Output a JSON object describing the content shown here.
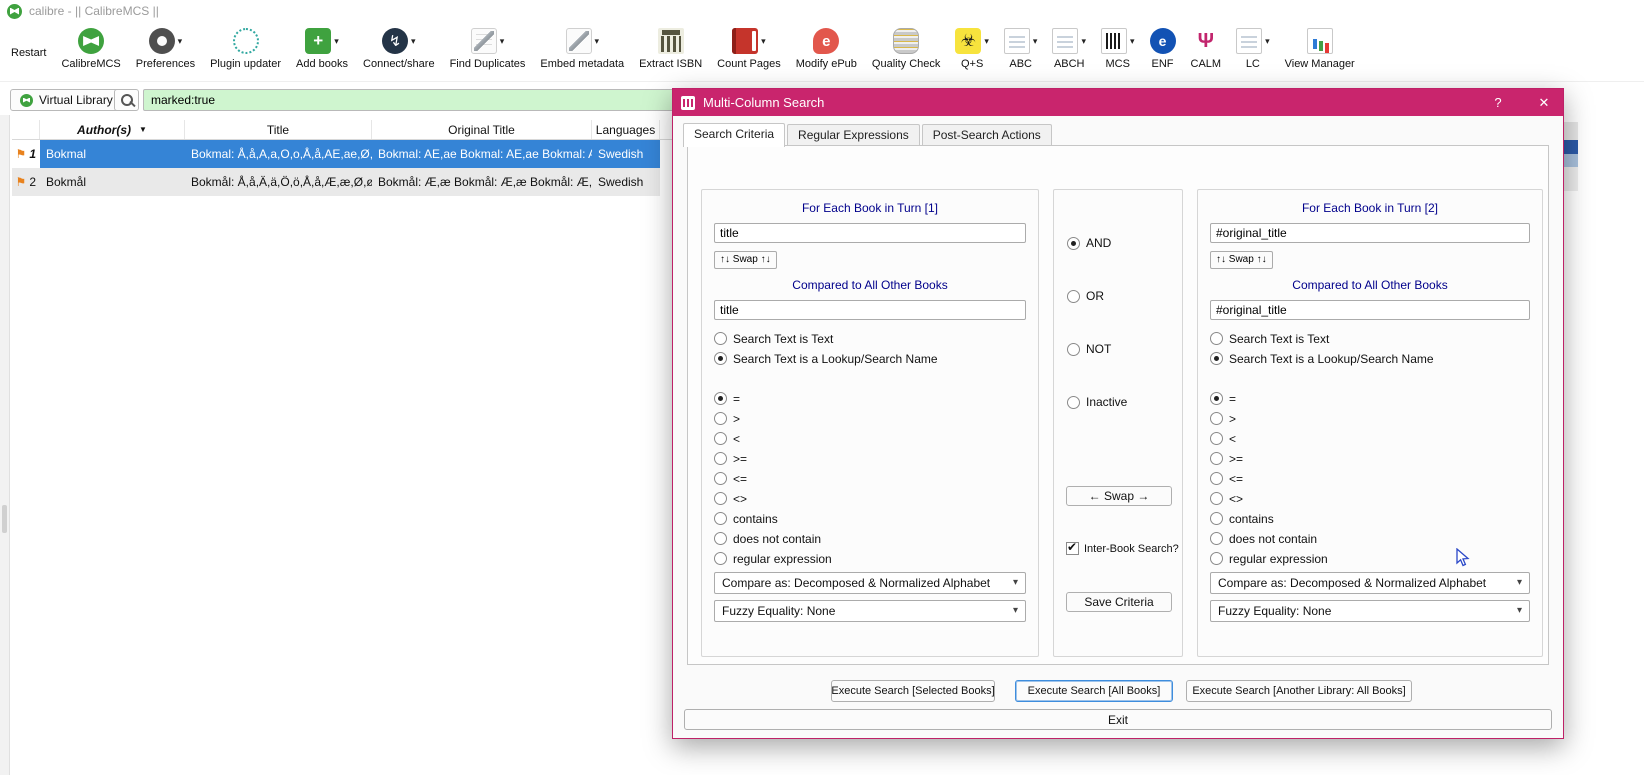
{
  "window": {
    "title": "calibre - || CalibreMCS ||"
  },
  "toolbar": {
    "items": [
      {
        "id": "restart",
        "label": "Restart",
        "icon": "none",
        "dropdown": false
      },
      {
        "id": "calibremcs",
        "label": "CalibreMCS",
        "icon": "calibre",
        "dropdown": false
      },
      {
        "id": "preferences",
        "label": "Preferences",
        "icon": "gear",
        "dropdown": true
      },
      {
        "id": "plugin-updater",
        "label": "Plugin updater",
        "icon": "plugin",
        "dropdown": false
      },
      {
        "id": "add-books",
        "label": "Add books",
        "icon": "add-books",
        "dropdown": true
      },
      {
        "id": "connect-share",
        "label": "Connect/share",
        "icon": "connect",
        "dropdown": true
      },
      {
        "id": "find-duplicates",
        "label": "Find Duplicates",
        "icon": "pencil-page",
        "dropdown": true
      },
      {
        "id": "embed-metadata",
        "label": "Embed metadata",
        "icon": "pencil",
        "dropdown": true
      },
      {
        "id": "extract-isbn",
        "label": "Extract ISBN",
        "icon": "isbn-building",
        "dropdown": false
      },
      {
        "id": "count-pages",
        "label": "Count Pages",
        "icon": "red-book",
        "dropdown": true
      },
      {
        "id": "modify-epub",
        "label": "Modify ePub",
        "icon": "epub",
        "dropdown": false
      },
      {
        "id": "quality-check",
        "label": "Quality Check",
        "icon": "coins",
        "dropdown": false
      },
      {
        "id": "q-s",
        "label": "Q+S",
        "icon": "biohazard",
        "dropdown": true
      },
      {
        "id": "abc",
        "label": "ABC",
        "icon": "card-abc",
        "dropdown": true
      },
      {
        "id": "abch",
        "label": "ABCH",
        "icon": "card-abch",
        "dropdown": true
      },
      {
        "id": "mcs",
        "label": "MCS",
        "icon": "barcode",
        "dropdown": true
      },
      {
        "id": "enf",
        "label": "ENF",
        "icon": "enf-circle",
        "dropdown": false
      },
      {
        "id": "calm",
        "label": "CALM",
        "icon": "trident",
        "dropdown": false
      },
      {
        "id": "lc",
        "label": "LC",
        "icon": "card-lc",
        "dropdown": true
      },
      {
        "id": "view-manager",
        "label": "View Manager",
        "icon": "bar-chart",
        "dropdown": false
      }
    ]
  },
  "searchbar": {
    "virtual_library": "Virtual Library",
    "query": "marked:true"
  },
  "book_table": {
    "columns": [
      "Author(s)",
      "Title",
      "Original Title",
      "Languages"
    ],
    "rows": [
      {
        "index": "1",
        "marked": true,
        "author": "Bokmal",
        "title": "Bokmal: Å,å,A,a,O,o,Å,å,AE,ae,Ø,ø",
        "original_title": "Bokmal: AE,ae  Bokmal: AE,ae  Bokmal: AE,ae",
        "languages": "Swedish",
        "selected": true
      },
      {
        "index": "2",
        "marked": true,
        "author": "Bokmål",
        "title": "Bokmål: Å,å,Ä,ä,Ö,ö,Å,å,Æ,æ,Ø,ø",
        "original_title": "Bokmål: Æ,æ  Bokmål: Æ,æ  Bokmål: Æ,æ",
        "languages": "Swedish",
        "selected": false
      }
    ]
  },
  "dialog": {
    "title": "Multi-Column Search",
    "help_button": "?",
    "close_button": "✕",
    "tabs": [
      "Search Criteria",
      "Regular Expressions",
      "Post-Search Actions"
    ],
    "active_tab": "Search Criteria",
    "left_panel": {
      "heading": "For Each Book in Turn [1]",
      "search_text": "title",
      "swap_button": "↑↓ Swap ↑↓",
      "compare_heading": "Compared to All Other Books",
      "compare_text": "title",
      "text_modes": [
        {
          "label": "Search Text is Text",
          "selected": false
        },
        {
          "label": "Search Text is a Lookup/Search Name",
          "selected": true
        }
      ],
      "operators": [
        {
          "label": "=",
          "selected": true
        },
        {
          "label": ">",
          "selected": false
        },
        {
          "label": "<",
          "selected": false
        },
        {
          "label": ">=",
          "selected": false
        },
        {
          "label": "<=",
          "selected": false
        },
        {
          "label": "<>",
          "selected": false
        },
        {
          "label": "contains",
          "selected": false
        },
        {
          "label": "does not contain",
          "selected": false
        },
        {
          "label": "regular expression",
          "selected": false
        }
      ],
      "compare_as": "Compare as: Decomposed & Normalized Alphabet",
      "fuzzy_equality": "Fuzzy Equality: None"
    },
    "middle_panel": {
      "logic_modes": [
        {
          "label": "AND",
          "selected": true
        },
        {
          "label": "OR",
          "selected": false
        },
        {
          "label": "NOT",
          "selected": false
        },
        {
          "label": "Inactive",
          "selected": false
        }
      ],
      "swap_button": "← Swap →",
      "inter_book_search": {
        "label": "Inter-Book Search?",
        "checked": true
      },
      "save_button": "Save Criteria"
    },
    "right_panel": {
      "heading": "For Each Book in Turn [2]",
      "search_text": "#original_title",
      "swap_button": "↑↓ Swap ↑↓",
      "compare_heading": "Compared to All Other Books",
      "compare_text": "#original_title",
      "text_modes": [
        {
          "label": "Search Text is Text",
          "selected": false
        },
        {
          "label": "Search Text is a Lookup/Search Name",
          "selected": true
        }
      ],
      "operators": [
        {
          "label": "=",
          "selected": true
        },
        {
          "label": ">",
          "selected": false
        },
        {
          "label": "<",
          "selected": false
        },
        {
          "label": ">=",
          "selected": false
        },
        {
          "label": "<=",
          "selected": false
        },
        {
          "label": "<>",
          "selected": false
        },
        {
          "label": "contains",
          "selected": false
        },
        {
          "label": "does not contain",
          "selected": false
        },
        {
          "label": "regular expression",
          "selected": false
        }
      ],
      "compare_as": "Compare as: Decomposed & Normalized Alphabet",
      "fuzzy_equality": "Fuzzy Equality: None"
    },
    "footer": {
      "buttons": [
        {
          "label": "Execute Search [Selected Books]",
          "focused": false
        },
        {
          "label": "Execute Search [All Books]",
          "focused": true
        },
        {
          "label": "Execute Search [Another Library: All Books]",
          "focused": false
        }
      ],
      "exit_button": "Exit"
    }
  }
}
